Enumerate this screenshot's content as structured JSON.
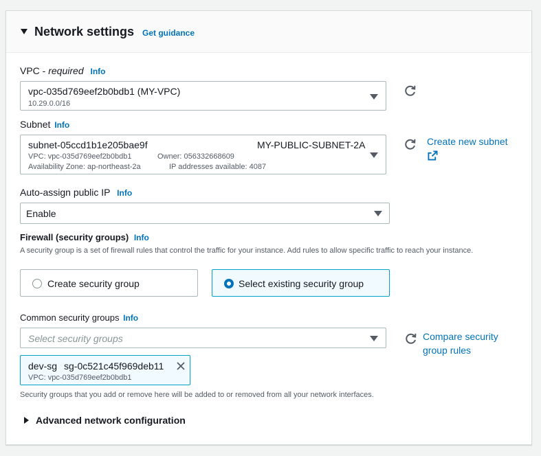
{
  "header": {
    "title": "Network settings",
    "guidance": "Get guidance"
  },
  "vpc": {
    "label": "VPC - ",
    "label_em": "required",
    "info": "Info",
    "value": "vpc-035d769eef2b0bdb1 (MY-VPC)",
    "cidr": "10.29.0.0/16"
  },
  "subnet": {
    "label": "Subnet",
    "info": "Info",
    "id": "subnet-05ccd1b1e205bae9f",
    "name": "MY-PUBLIC-SUBNET-2A",
    "vpc": "VPC: vpc-035d769eef2b0bdb1",
    "owner": "Owner: 056332668609",
    "az": "Availability Zone: ap-northeast-2a",
    "ips": "IP addresses available: 4087",
    "create_link": "Create new subnet"
  },
  "public_ip": {
    "label": "Auto-assign public IP",
    "info": "Info",
    "value": "Enable"
  },
  "firewall": {
    "label": "Firewall (security groups)",
    "info": "Info",
    "description": "A security group is a set of firewall rules that control the traffic for your instance. Add rules to allow specific traffic to reach your instance.",
    "option_create": "Create security group",
    "option_select": "Select existing security group",
    "selected": "select"
  },
  "common_sg": {
    "label": "Common security groups",
    "info": "Info",
    "placeholder": "Select security groups",
    "compare_link_1": "Compare security",
    "compare_link_2": "group rules",
    "token_name": "dev-sg",
    "token_id": "sg-0c521c45f969deb11",
    "token_vpc": "VPC: vpc-035d769eef2b0bdb1",
    "note": "Security groups that you add or remove here will be added to or removed from all your network interfaces."
  },
  "advanced": {
    "label": "Advanced network configuration"
  },
  "colors": {
    "link": "#0073bb",
    "selected_border": "#00a1c9",
    "selected_bg": "#f1faff"
  }
}
